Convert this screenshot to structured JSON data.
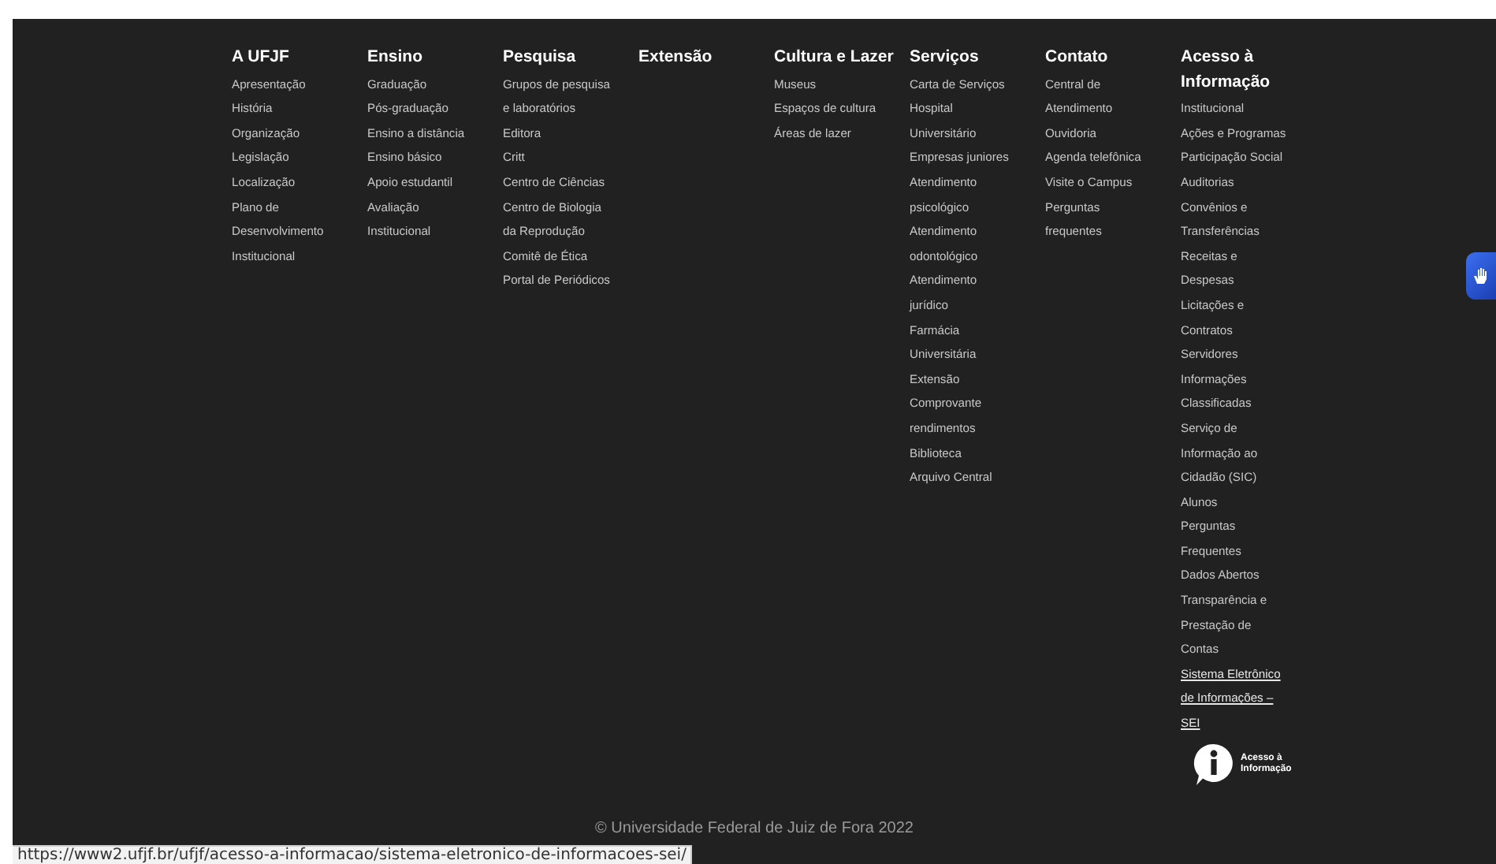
{
  "footer": {
    "columns": [
      {
        "heading": "A UFJF",
        "items": [
          {
            "text": "Apresentação"
          },
          {
            "text": "História"
          },
          {
            "text": "Organização"
          },
          {
            "text": "Legislação"
          },
          {
            "text": "Localização"
          },
          {
            "text": "Plano de\nDesenvolvimento\nInstitucional"
          }
        ]
      },
      {
        "heading": "Ensino",
        "items": [
          {
            "text": "Graduação"
          },
          {
            "text": "Pós-graduação"
          },
          {
            "text": "Ensino a distância"
          },
          {
            "text": "Ensino básico"
          },
          {
            "text": "Apoio estudantil"
          },
          {
            "text": "Avaliação\nInstitucional"
          }
        ]
      },
      {
        "heading": "Pesquisa",
        "items": [
          {
            "text": "Grupos de pesquisa\ne laboratórios"
          },
          {
            "text": "Editora"
          },
          {
            "text": "Critt"
          },
          {
            "text": "Centro de Ciências"
          },
          {
            "text": "Centro de Biologia\nda Reprodução"
          },
          {
            "text": "Comitê de Ética"
          },
          {
            "text": "Portal de Periódicos"
          }
        ]
      },
      {
        "heading": "Extensão"
      },
      {
        "heading": "Cultura e Lazer",
        "items": [
          {
            "text": "Museus"
          },
          {
            "text": "Espaços de cultura"
          },
          {
            "text": "Áreas de lazer"
          }
        ]
      },
      {
        "heading": "Serviços",
        "items": [
          {
            "text": "Carta de Serviços"
          },
          {
            "text": "Hospital\nUniversitário"
          },
          {
            "text": "Empresas juniores"
          },
          {
            "text": "Atendimento\npsicológico"
          },
          {
            "text": "Atendimento\nodontológico"
          },
          {
            "text": "Atendimento\njurídico"
          },
          {
            "text": "Farmácia\nUniversitária"
          },
          {
            "text": "Extensão"
          },
          {
            "text": "Comprovante\nrendimentos"
          },
          {
            "text": "Biblioteca"
          },
          {
            "text": "Arquivo Central"
          }
        ]
      },
      {
        "heading": "Contato",
        "items": [
          {
            "text": "Central de\nAtendimento"
          },
          {
            "text": "Ouvidoria"
          },
          {
            "text": "Agenda telefônica"
          },
          {
            "text": "Visite o Campus"
          },
          {
            "text": "Perguntas\nfrequentes"
          }
        ]
      },
      {
        "heading": "Acesso à\nInformação",
        "items": [
          {
            "text": "Institucional",
            "hovered": false
          },
          {
            "text": "Ações e Programas",
            "hovered": false
          },
          {
            "text": "Participação Social",
            "hovered": false
          },
          {
            "text": "Auditorias",
            "hovered": false
          },
          {
            "text": "Convênios e\nTransferências",
            "hovered": false
          },
          {
            "text": "Receitas e\nDespesas",
            "hovered": false
          },
          {
            "text": "Licitações e\nContratos",
            "hovered": false
          },
          {
            "text": "Servidores",
            "hovered": false
          },
          {
            "text": "Informações\nClassificadas",
            "hovered": false
          },
          {
            "text": "Serviço de\nInformação ao\nCidadão (SIC)",
            "hovered": false
          },
          {
            "text": "Alunos",
            "hovered": false
          },
          {
            "text": "Perguntas\nFrequentes",
            "hovered": false
          },
          {
            "text": "Dados Abertos",
            "hovered": false
          },
          {
            "text": "Transparência e\nPrestação de\nContas",
            "hovered": false
          },
          {
            "text": "Sistema Eletrônico\nde Informações –\nSEI",
            "hovered": true
          }
        ],
        "logo": {
          "text": "Acesso à\nInformação"
        }
      }
    ],
    "copyright": "© Universidade Federal de Juiz de Fora 2022"
  },
  "status_bar": {
    "url": "https://www2.ufjf.br/ufjf/acesso-a-informacao/sistema-eletronico-de-informacoes-sei/"
  }
}
